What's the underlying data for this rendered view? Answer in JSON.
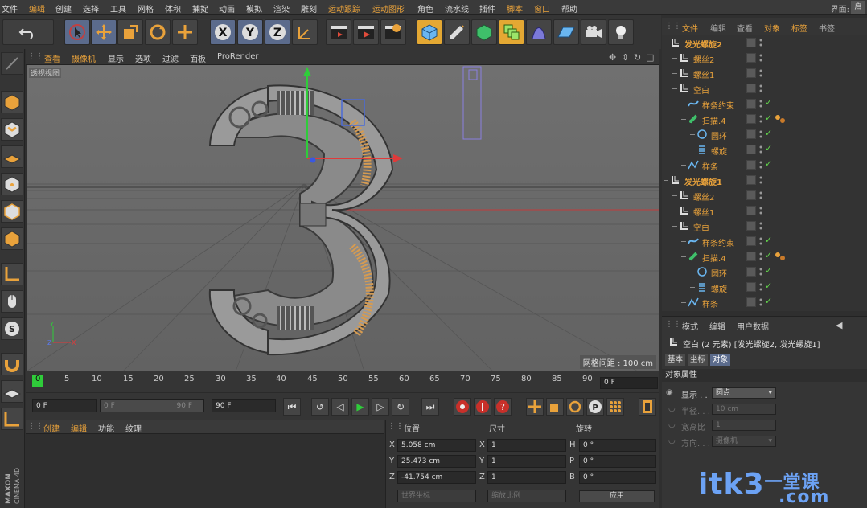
{
  "menubar": {
    "items": [
      "文件",
      "编辑",
      "创建",
      "选择",
      "工具",
      "网格",
      "体积",
      "捕捉",
      "动画",
      "模拟",
      "渲染",
      "雕刻",
      "运动跟踪",
      "运动图形",
      "角色",
      "流水线",
      "插件",
      "脚本",
      "窗口",
      "帮助"
    ],
    "layout_label": "界面:",
    "layout_value": "启"
  },
  "toolbar": {
    "undo": "undo-icon",
    "tools": [
      "select-icon",
      "move-icon",
      "scale-icon",
      "rotate-icon",
      "move-icon"
    ],
    "axes": [
      "X",
      "Y",
      "Z"
    ]
  },
  "viewport": {
    "menu": [
      "查看",
      "摄像机",
      "显示",
      "选项",
      "过滤",
      "面板",
      "ProRender"
    ],
    "view_label": "透视视图",
    "grid_label": "网格间距 : 100 cm"
  },
  "timeline": {
    "ticks": [
      "0",
      "5",
      "10",
      "15",
      "20",
      "25",
      "30",
      "35",
      "40",
      "45",
      "50",
      "55",
      "60",
      "65",
      "70",
      "75",
      "80",
      "85",
      "90"
    ],
    "current_frame": "0 F",
    "start": "0 F",
    "range_start": "0 F",
    "range_end": "90 F",
    "end": "90 F"
  },
  "materials": {
    "menu": [
      "创建",
      "编辑",
      "功能",
      "纹理"
    ]
  },
  "coordinates": {
    "headers": [
      "位置",
      "尺寸",
      "旋转"
    ],
    "rows": [
      {
        "axis": "X",
        "pos": "5.058 cm",
        "size_axis": "X",
        "size": "1",
        "rot_axis": "H",
        "rot": "0 °"
      },
      {
        "axis": "Y",
        "pos": "25.473 cm",
        "size_axis": "Y",
        "size": "1",
        "rot_axis": "P",
        "rot": "0 °"
      },
      {
        "axis": "Z",
        "pos": "-41.754 cm",
        "size_axis": "Z",
        "size": "1",
        "rot_axis": "B",
        "rot": "0 °"
      }
    ],
    "mode_world": "世界坐标",
    "mode_scale": "缩放比例",
    "apply": "应用"
  },
  "object_manager": {
    "menu": [
      "文件",
      "编辑",
      "查看",
      "对象",
      "标签",
      "书签"
    ],
    "objects": [
      {
        "name": "发光螺旋2",
        "bold": true,
        "icon": "null-icon",
        "check": false,
        "tag": false
      },
      {
        "name": "螺丝2",
        "bold": false,
        "icon": "null-icon",
        "check": false,
        "tag": false
      },
      {
        "name": "螺丝1",
        "bold": false,
        "icon": "null-icon",
        "check": false,
        "tag": false
      },
      {
        "name": "空白",
        "bold": false,
        "icon": "null-icon",
        "check": false,
        "tag": false
      },
      {
        "name": "样条约束",
        "bold": false,
        "icon": "spline-wrap-icon",
        "check": true,
        "tag": false
      },
      {
        "name": "扫描.4",
        "bold": false,
        "icon": "sweep-icon",
        "check": true,
        "tag": true
      },
      {
        "name": "圆环",
        "bold": false,
        "icon": "circle-icon",
        "check": true,
        "tag": false
      },
      {
        "name": "螺旋",
        "bold": false,
        "icon": "helix-icon",
        "check": true,
        "tag": false
      },
      {
        "name": "样条",
        "bold": false,
        "icon": "spline-icon",
        "check": true,
        "tag": false
      },
      {
        "name": "发光螺旋1",
        "bold": true,
        "icon": "null-icon",
        "check": false,
        "tag": false
      },
      {
        "name": "螺丝2",
        "bold": false,
        "icon": "null-icon",
        "check": false,
        "tag": false
      },
      {
        "name": "螺丝1",
        "bold": false,
        "icon": "null-icon",
        "check": false,
        "tag": false
      },
      {
        "name": "空白",
        "bold": false,
        "icon": "null-icon",
        "check": false,
        "tag": false
      },
      {
        "name": "样条约束",
        "bold": false,
        "icon": "spline-wrap-icon",
        "check": true,
        "tag": false
      },
      {
        "name": "扫描.4",
        "bold": false,
        "icon": "sweep-icon",
        "check": true,
        "tag": true
      },
      {
        "name": "圆环",
        "bold": false,
        "icon": "circle-icon",
        "check": true,
        "tag": false
      },
      {
        "name": "螺旋",
        "bold": false,
        "icon": "helix-icon",
        "check": true,
        "tag": false
      },
      {
        "name": "样条",
        "bold": false,
        "icon": "spline-icon",
        "check": true,
        "tag": false
      }
    ]
  },
  "attributes": {
    "menu": [
      "模式",
      "编辑",
      "用户数据"
    ],
    "title": "空白 (2 元素) [发光螺旋2, 发光螺旋1]",
    "tabs": [
      "基本",
      "坐标",
      "对象"
    ],
    "section": "对象属性",
    "display_label": "显示 . .",
    "display_value": "圆点",
    "radius_label": "半径. . .",
    "radius_value": "10 cm",
    "aspect_label": "宽高比",
    "aspect_value": "1",
    "orientation_label": "方向. . .",
    "orientation_value": "摄像机"
  },
  "branding": {
    "maxon": "MAXON",
    "cinema": "CINEMA 4D",
    "watermark_main": "itk3",
    "watermark_domain": ".com",
    "watermark_cn": "一堂课"
  },
  "colors": {
    "accent": "#e9a23b",
    "check": "#62d44b",
    "selected": "#5b6b8c",
    "viewport": "#6b6b6b"
  }
}
